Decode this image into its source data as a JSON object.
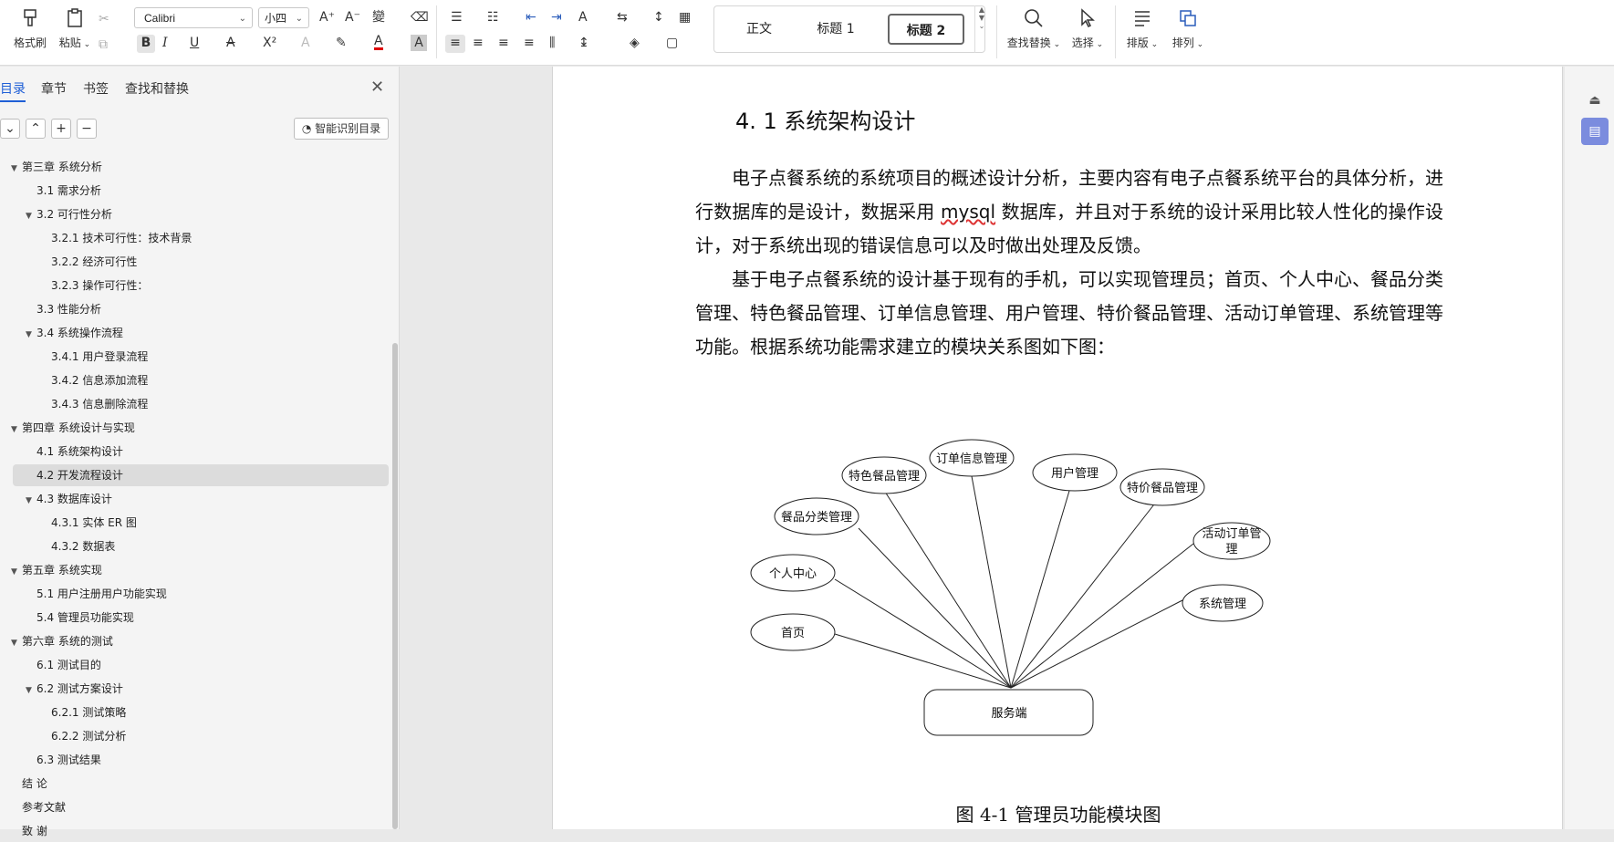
{
  "toolbar": {
    "format_painter": "格式刷",
    "paste": "粘贴",
    "font_name": "Calibri",
    "font_size": "小四",
    "styles": [
      "正文",
      "标题 1",
      "标题 2"
    ],
    "find_replace": "查找替换",
    "select": "选择",
    "layout": "排版",
    "arrange": "排列"
  },
  "nav": {
    "tabs": [
      "目录",
      "章节",
      "书签",
      "查找和替换"
    ],
    "smart_button": "智能识别目录",
    "toc": [
      {
        "label": "第三章  系统分析",
        "level": 0,
        "toggle": true
      },
      {
        "label": "3.1 需求分析",
        "level": 1,
        "toggle": false
      },
      {
        "label": "3.2 可行性分析",
        "level": 1,
        "toggle": true
      },
      {
        "label": "3.2.1 技术可行性：技术背景",
        "level": 2,
        "toggle": false
      },
      {
        "label": "3.2.2 经济可行性",
        "level": 2,
        "toggle": false
      },
      {
        "label": "3.2.3 操作可行性：",
        "level": 2,
        "toggle": false
      },
      {
        "label": "3.3 性能分析",
        "level": 1,
        "toggle": false
      },
      {
        "label": "3.4 系统操作流程",
        "level": 1,
        "toggle": true
      },
      {
        "label": "3.4.1 用户登录流程",
        "level": 2,
        "toggle": false
      },
      {
        "label": "3.4.2 信息添加流程",
        "level": 2,
        "toggle": false
      },
      {
        "label": "3.4.3 信息删除流程",
        "level": 2,
        "toggle": false
      },
      {
        "label": "第四章  系统设计与实现",
        "level": 0,
        "toggle": true
      },
      {
        "label": "4.1 系统架构设计",
        "level": 1,
        "toggle": false
      },
      {
        "label": "4.2 开发流程设计",
        "level": 1,
        "toggle": false,
        "selected": true
      },
      {
        "label": "4.3 数据库设计",
        "level": 1,
        "toggle": true
      },
      {
        "label": "4.3.1 实体 ER 图",
        "level": 2,
        "toggle": false
      },
      {
        "label": "4.3.2 数据表",
        "level": 2,
        "toggle": false
      },
      {
        "label": "第五章  系统实现",
        "level": 0,
        "toggle": true
      },
      {
        "label": "5.1 用户注册用户功能实现",
        "level": 1,
        "toggle": false
      },
      {
        "label": "5.4  管理员功能实现",
        "level": 1,
        "toggle": false
      },
      {
        "label": "第六章    系统的测试",
        "level": 0,
        "toggle": true
      },
      {
        "label": "6.1  测试目的",
        "level": 1,
        "toggle": false
      },
      {
        "label": "6.2  测试方案设计",
        "level": 1,
        "toggle": true
      },
      {
        "label": "6.2.1  测试策略",
        "level": 2,
        "toggle": false
      },
      {
        "label": "6.2.2  测试分析",
        "level": 2,
        "toggle": false
      },
      {
        "label": "6.3  测试结果",
        "level": 1,
        "toggle": false
      },
      {
        "label": "结    论",
        "level": 0,
        "toggle": false
      },
      {
        "label": "参考文献",
        "level": 0,
        "toggle": false
      },
      {
        "label": "致    谢",
        "level": 0,
        "toggle": false
      }
    ]
  },
  "document": {
    "heading": "4. 1 系统架构设计",
    "para1_before": "电子点餐系统的系统项目的概述设计分析，主要内容有电子点餐系统平台的具体分析，进行数据库的是设计，数据采用 ",
    "para1_mysql": "mysql",
    "para1_after": " 数据库，并且对于系统的设计采用比较人性化的操作设计，对于系统出现的错误信息可以及时做出处理及反馈。",
    "para2": "基于电子点餐系统的设计基于现有的手机，可以实现管理员；首页、个人中心、餐品分类管理、特色餐品管理、订单信息管理、用户管理、特价餐品管理、活动订单管理、系统管理等功能。根据系统功能需求建立的模块关系图如下图：",
    "diagram": {
      "center": "服务端",
      "modules": [
        "首页",
        "个人中心",
        "餐品分类管理",
        "特色餐品管理",
        "订单信息管理",
        "用户管理",
        "特价餐品管理",
        "活动订单管理",
        "系统管理"
      ]
    },
    "caption": "图 4-1 管理员功能模块图"
  }
}
